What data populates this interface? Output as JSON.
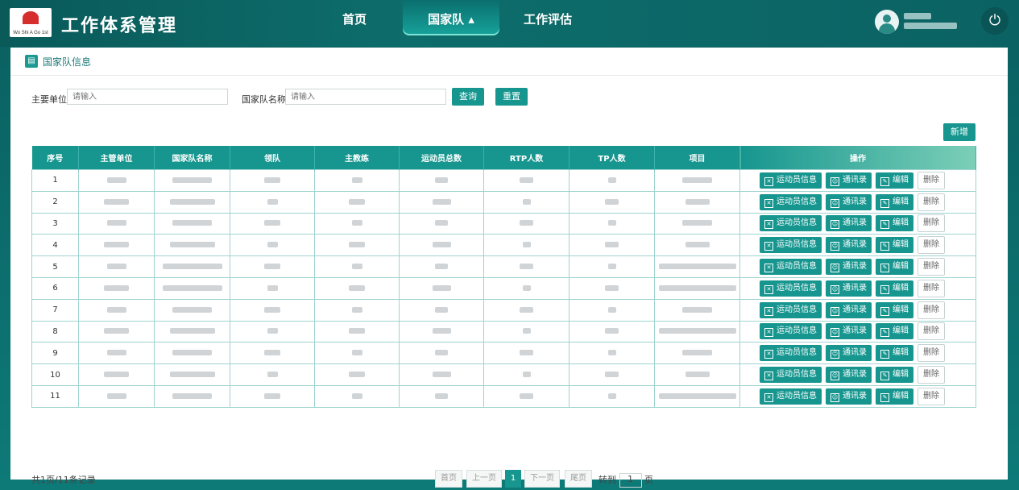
{
  "header": {
    "logo_text": "Wo Shi A Go 1st",
    "app_title": "工作体系管理",
    "nav": [
      {
        "label": "首页",
        "active": false
      },
      {
        "label": "国家队 ▴",
        "active": true
      },
      {
        "label": "工作评估",
        "active": false
      }
    ],
    "power_icon": "power-icon"
  },
  "breadcrumb": {
    "title": "国家队信息"
  },
  "filters": {
    "unit_label": "主要单位",
    "unit_placeholder": "请输入",
    "team_label": "国家队名称",
    "team_placeholder": "请输入",
    "search_label": "查询",
    "reset_label": "重置",
    "add_label": "新增"
  },
  "table": {
    "columns": [
      "序号",
      "主管单位",
      "国家队名称",
      "领队",
      "主教练",
      "运动员总数",
      "RTP人数",
      "TP人数",
      "项目",
      "操作"
    ],
    "rows": [
      {
        "no": "1"
      },
      {
        "no": "2"
      },
      {
        "no": "3"
      },
      {
        "no": "4"
      },
      {
        "no": "5"
      },
      {
        "no": "6"
      },
      {
        "no": "7"
      },
      {
        "no": "8"
      },
      {
        "no": "9"
      },
      {
        "no": "10"
      },
      {
        "no": "11"
      }
    ],
    "actions": {
      "athlete": "运动员信息",
      "contacts": "通讯录",
      "edit": "编辑",
      "delete": "删除"
    }
  },
  "pagination": {
    "summary": "共1页/11条记录",
    "first": "首页",
    "prev": "上一页",
    "current": "1",
    "next": "下一页",
    "last": "尾页",
    "goto_prefix": "转到",
    "goto_value": "1",
    "goto_suffix": "页"
  }
}
